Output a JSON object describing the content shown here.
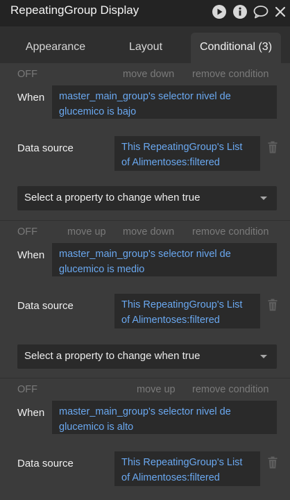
{
  "window": {
    "title": "RepeatingGroup Display",
    "icons": [
      "play-icon",
      "info-icon",
      "comment-icon",
      "close-icon"
    ]
  },
  "tabs": [
    {
      "label": "Appearance",
      "active": false
    },
    {
      "label": "Layout",
      "active": false
    },
    {
      "label": "Conditional (3)",
      "active": true
    }
  ],
  "conditions": [
    {
      "off": "OFF",
      "move_down": "move down",
      "remove": "remove condition",
      "when_label": "When",
      "when_value": "master_main_group's selector nivel de glucemico is bajo",
      "ds_label": "Data source",
      "ds_value": "This RepeatingGroup's List of Alimentoses:filtered",
      "select_label": "Select a property to change when true"
    },
    {
      "off": "OFF",
      "move_up": "move up",
      "move_down": "move down",
      "remove": "remove condition",
      "when_label": "When",
      "when_value": "master_main_group's selector nivel de glucemico is medio",
      "ds_label": "Data source",
      "ds_value": "This RepeatingGroup's List of Alimentoses:filtered",
      "select_label": "Select a property to change when true"
    },
    {
      "off": "OFF",
      "move_up": "move up",
      "remove": "remove condition",
      "when_label": "When",
      "when_value": "master_main_group's selector nivel de glucemico is alto",
      "ds_label": "Data source",
      "ds_value": "This RepeatingGroup's List of Alimentoses:filtered"
    }
  ],
  "colors": {
    "background": "#3b3b3b",
    "titlebar": "#232323",
    "field": "#2a2a2a",
    "link_text": "#6aa8f0",
    "muted_text": "#7a7a7a"
  }
}
